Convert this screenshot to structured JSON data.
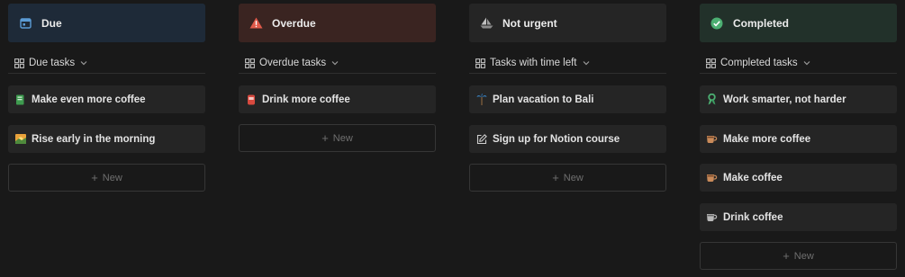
{
  "colors": {
    "background": "#191919",
    "card": "#252525",
    "due_header": "#1e2a38",
    "overdue_header": "#3a2421",
    "not_urgent_header": "#252525",
    "completed_header": "#22312a",
    "completed_check": "#4caf72",
    "warning_red": "#e05a4a",
    "due_blue": "#5b9bd5"
  },
  "columns": [
    {
      "title": "Due",
      "icon": "calendar-icon",
      "view_label": "Due tasks",
      "cards": [
        {
          "label": "Make even more coffee",
          "icon": "green-book-icon"
        },
        {
          "label": "Rise early in the morning",
          "icon": "sunrise-icon"
        }
      ],
      "new_label": "New"
    },
    {
      "title": "Overdue",
      "icon": "warning-icon",
      "view_label": "Overdue tasks",
      "cards": [
        {
          "label": "Drink more coffee",
          "icon": "red-can-icon"
        }
      ],
      "new_label": "New"
    },
    {
      "title": "Not urgent",
      "icon": "sailboat-icon",
      "view_label": "Tasks with time left",
      "cards": [
        {
          "label": "Plan vacation to Bali",
          "icon": "palm-tree-icon"
        },
        {
          "label": "Sign up for Notion course",
          "icon": "edit-icon"
        }
      ],
      "new_label": "New"
    },
    {
      "title": "Completed",
      "icon": "check-circle-icon",
      "view_label": "Completed tasks",
      "cards": [
        {
          "label": "Work smarter, not harder",
          "icon": "ribbon-icon"
        },
        {
          "label": "Make more coffee",
          "icon": "coffee-icon"
        },
        {
          "label": "Make coffee",
          "icon": "coffee-icon"
        },
        {
          "label": "Drink coffee",
          "icon": "coffee-icon"
        }
      ],
      "new_label": "New"
    }
  ]
}
